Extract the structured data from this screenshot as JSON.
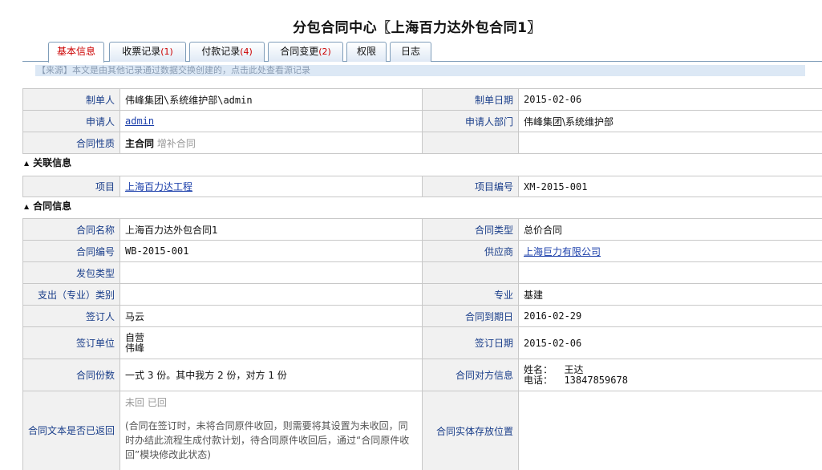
{
  "title": "分包合同中心〖上海百力达外包合同1〗",
  "tabs": [
    {
      "label": "基本信息",
      "count": ""
    },
    {
      "label": "收票记录",
      "count": "(1)"
    },
    {
      "label": "付款记录",
      "count": "(4)"
    },
    {
      "label": "合同变更",
      "count": "(2)"
    },
    {
      "label": "权限",
      "count": ""
    },
    {
      "label": "日志",
      "count": ""
    }
  ],
  "source_note": "【来源】本文是由其他记录通过数据交换创建的，点击此处查看源记录",
  "basic": {
    "maker_label": "制单人",
    "maker_value": "伟峰集团\\系统维护部\\admin",
    "make_date_label": "制单日期",
    "make_date_value": "2015-02-06",
    "applicant_label": "申请人",
    "applicant_value": "admin",
    "applicant_dept_label": "申请人部门",
    "applicant_dept_value": "伟峰集团\\系统维护部",
    "nature_label": "合同性质",
    "nature_main": "主合同",
    "nature_supplement": "增补合同"
  },
  "related": {
    "section_title": "关联信息",
    "project_label": "项目",
    "project_value": "上海百力达工程",
    "project_no_label": "项目编号",
    "project_no_value": "XM-2015-001"
  },
  "contract": {
    "section_title": "合同信息",
    "name_label": "合同名称",
    "name_value": "上海百力达外包合同1",
    "type_label": "合同类型",
    "type_value": "总价合同",
    "no_label": "合同编号",
    "no_value": "WB-2015-001",
    "supplier_label": "供应商",
    "supplier_value": "上海巨力有限公司",
    "subcontract_type_label": "发包类型",
    "expense_category_label": "支出（专业）类别",
    "major_label": "专业",
    "major_value": "基建",
    "signer_label": "签订人",
    "signer_value": "马云",
    "due_date_label": "合同到期日",
    "due_date_value": "2016-02-29",
    "sign_unit_label": "签订单位",
    "sign_unit_line1": "自营",
    "sign_unit_line2": "伟峰",
    "sign_date_label": "签订日期",
    "sign_date_value": "2015-02-06",
    "copies_label": "合同份数",
    "copies_value": "一式 3 份。其中我方 2 份，对方 1 份",
    "counterparty_label": "合同对方信息",
    "counterparty_name_line": "姓名：  王达",
    "counterparty_phone_line": "电话：  13847859678",
    "returned_label": "合同文本是否已返回",
    "returned_no": "未回",
    "returned_yes": "已回",
    "returned_hint": "(合同在签订时，未将合同原件收回，则需要将其设置为未收回，同时办结此流程生成付款计划，待合同原件收回后，通过“合同原件收回”模块修改此状态)",
    "storage_label": "合同实体存放位置"
  }
}
